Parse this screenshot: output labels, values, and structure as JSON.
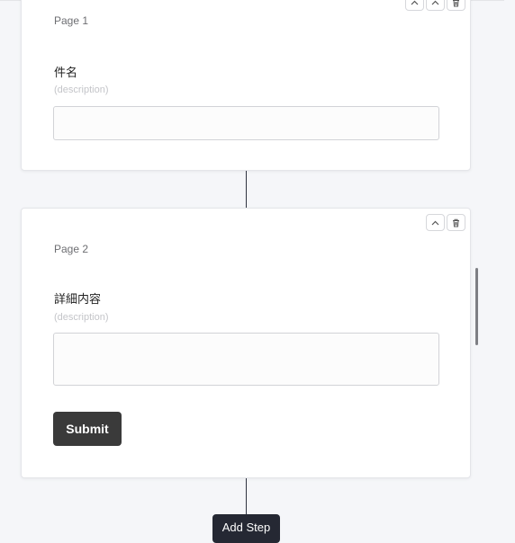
{
  "steps": [
    {
      "page_label": "Page 1",
      "field_label": "件名",
      "field_description": "(description)",
      "field_value": ""
    },
    {
      "page_label": "Page 2",
      "field_label": "詳細内容",
      "field_description": "(description)",
      "field_value": "",
      "submit_label": "Submit"
    }
  ],
  "add_step_label": "Add Step",
  "colors": {
    "background": "#f5f6f9",
    "card": "#ffffff",
    "submit_button": "#3a3a3a",
    "add_step_button": "#252833",
    "connector": "#2f3340"
  },
  "icons": {
    "move_up": "chevron-up-icon",
    "delete": "trash-icon"
  }
}
